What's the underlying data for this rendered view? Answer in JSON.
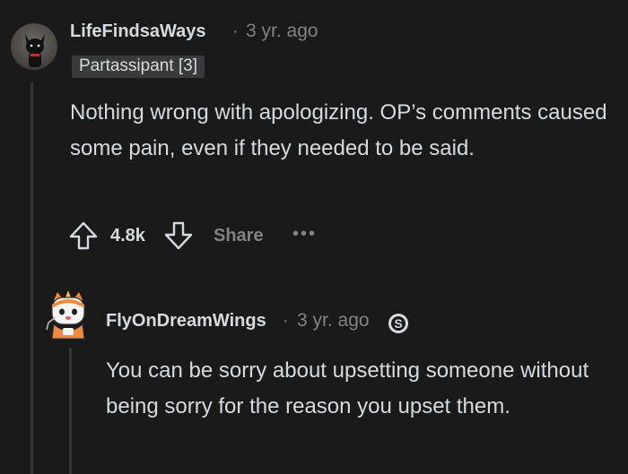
{
  "comments": [
    {
      "username": "LifeFindsaWays",
      "separator": "·",
      "time": "3 yr. ago",
      "flair": "Partassipant [3]",
      "body": "Nothing wrong with apologizing. OP’s comments caused some pain, even if they needed to be said.",
      "score": "4.8k",
      "share_label": "Share",
      "more_label": "•••"
    },
    {
      "username": "FlyOnDreamWings",
      "separator": "·",
      "time": "3 yr. ago",
      "body": "You can be sorry about upsetting someone without being sorry for the reason you upset them."
    }
  ],
  "colors": {
    "background": "#1a1a1b",
    "text": "#d7dadc",
    "muted": "#818384",
    "flair_bg": "#3a3a3c",
    "thread_line": "#343536"
  },
  "icons": {
    "upvote": "arrow-up-outline-icon",
    "downvote": "arrow-down-outline-icon",
    "more": "ellipsis-icon",
    "award": "s-coin-icon"
  }
}
